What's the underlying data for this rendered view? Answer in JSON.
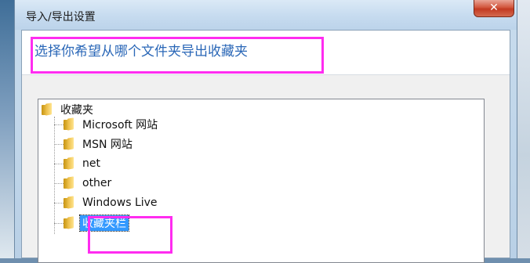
{
  "window": {
    "title": "导入/导出设置",
    "close_glyph": "✕"
  },
  "header": {
    "instruction": "选择你希望从哪个文件夹导出收藏夹"
  },
  "tree": {
    "root": "收藏夹",
    "children": [
      {
        "label": "Microsoft 网站"
      },
      {
        "label": "MSN 网站"
      },
      {
        "label": "net"
      },
      {
        "label": "other"
      },
      {
        "label": "Windows Live"
      },
      {
        "label": "收藏夹栏",
        "selected": true
      }
    ]
  },
  "colors": {
    "highlight_box": "#ff2cf0",
    "instruction_text": "#2a67b7",
    "selection": "#3399ff"
  }
}
